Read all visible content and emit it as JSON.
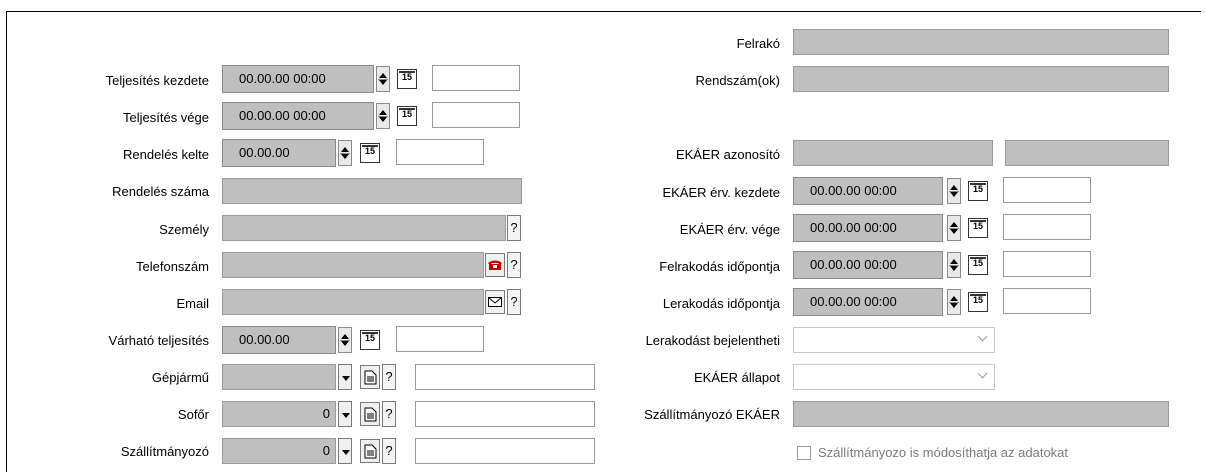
{
  "left": {
    "labels": {
      "teljesites_kezdete": "Teljesítés kezdete",
      "teljesites_vege": "Teljesítés vége",
      "rendeles_kelte": "Rendelés kelte",
      "rendeles_szama": "Rendelés száma",
      "szemely": "Személy",
      "telefonszam": "Telefonszám",
      "email": "Email",
      "varhato_teljesites": "Várható teljesítés",
      "gepjarmu": "Gépjármű",
      "sofor": "Sofőr",
      "szallitmanyozo": "Szállítmányozó"
    },
    "values": {
      "teljesites_kezdete": "00.00.00 00:00",
      "teljesites_vege": "00.00.00 00:00",
      "rendeles_kelte": "00.00.00",
      "varhato_teljesites": "00.00.00",
      "sofor": "0",
      "szallitmanyozo": "0"
    }
  },
  "right": {
    "labels": {
      "felrako": "Felrakó",
      "rendszamok": "Rendszám(ok)",
      "ekaer_azonosito": "EKÁER azonosító",
      "ekaer_erv_kezdete": "EKÁER érv. kezdete",
      "ekaer_erv_vege": "EKÁER érv. vége",
      "felrakodas_idopontja": "Felrakodás időpontja",
      "lerakodas_idopontja": "Lerakodás időpontja",
      "lerakodast_bejelentheti": "Lerakodást bejelentheti",
      "ekaer_allapot": "EKÁER állapot",
      "szallitmanyozo_ekaer": "Szállítmányozó EKÁER"
    },
    "values": {
      "ekaer_erv_kezdete": "00.00.00 00:00",
      "ekaer_erv_vege": "00.00.00 00:00",
      "felrakodas_idopontja": "00.00.00 00:00",
      "lerakodas_idopontja": "00.00.00 00:00"
    },
    "checkbox_label": "Szállítmányozo is módosíthatja az adatokat"
  },
  "buttons": {
    "help": "?",
    "calendar": "15"
  }
}
